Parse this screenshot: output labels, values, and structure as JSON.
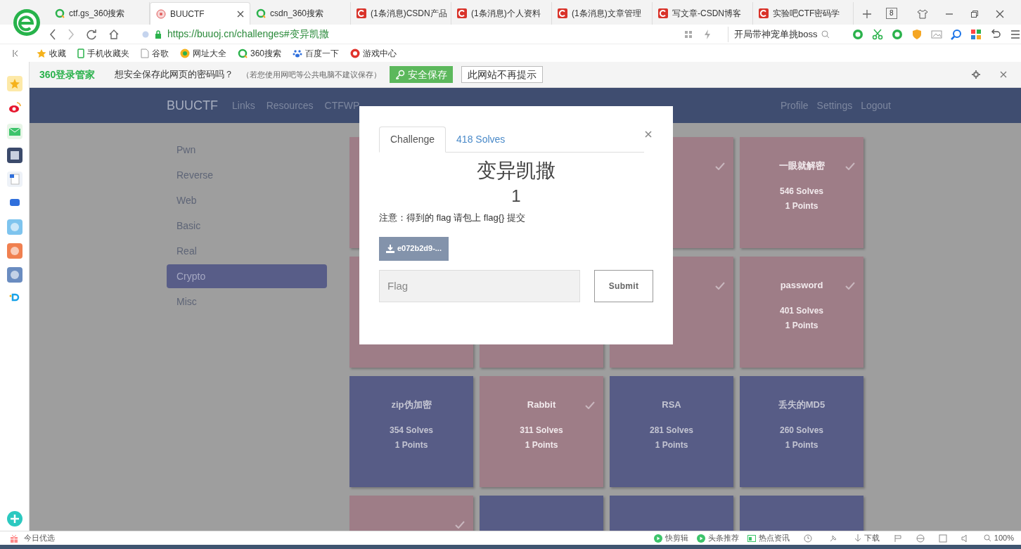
{
  "browser": {
    "tabs": [
      {
        "title": "ctf.gs_360搜索",
        "kind": "search",
        "selected": false
      },
      {
        "title": "BUUCTF",
        "kind": "site",
        "selected": true
      },
      {
        "title": "csdn_360搜索",
        "kind": "search",
        "selected": false
      },
      {
        "title": "(1条消息)CSDN产品",
        "kind": "csdn",
        "selected": false
      },
      {
        "title": "(1条消息)个人资料",
        "kind": "csdn",
        "selected": false
      },
      {
        "title": "(1条消息)文章管理",
        "kind": "csdn",
        "selected": false
      },
      {
        "title": "写文章-CSDN博客",
        "kind": "csdn",
        "selected": false
      },
      {
        "title": "实验吧CTF密码学",
        "kind": "csdn",
        "selected": false
      }
    ],
    "tab_count": "8",
    "address": "https://buuoj.cn/challenges#变异凯撒",
    "search": "开局带神宠单挑boss",
    "bookmarks": [
      {
        "label": "收藏",
        "kind": "star"
      },
      {
        "label": "手机收藏夹",
        "kind": "phone"
      },
      {
        "label": "谷歌",
        "kind": "page"
      },
      {
        "label": "网址大全",
        "kind": "globe"
      },
      {
        "label": "360搜索",
        "kind": "search"
      },
      {
        "label": "百度一下",
        "kind": "paw"
      },
      {
        "label": "游戏中心",
        "kind": "game"
      }
    ],
    "password_bar": {
      "brand": "360登录管家",
      "prompt": "想安全保存此网页的密码吗？",
      "note": "（若您使用网吧等公共电脑不建议保存）",
      "save": "安全保存",
      "never": "此网站不再提示"
    }
  },
  "page": {
    "nav": {
      "brand": "BUUCTF",
      "links": [
        "Links",
        "Resources",
        "CTFWP"
      ],
      "right_links": [
        "Profile",
        "Settings",
        "Logout"
      ]
    },
    "categories": [
      {
        "label": "Pwn",
        "selected": false
      },
      {
        "label": "Reverse",
        "selected": false
      },
      {
        "label": "Web",
        "selected": false
      },
      {
        "label": "Basic",
        "selected": false
      },
      {
        "label": "Real",
        "selected": false
      },
      {
        "label": "Crypto",
        "selected": true
      },
      {
        "label": "Misc",
        "selected": false
      }
    ],
    "challenges": [
      {
        "solved": true
      },
      {
        "solved": true
      },
      {
        "title": "一眼就解密",
        "solves": "546 Solves",
        "points": "1 Points",
        "solved": true
      },
      {
        "solved": true
      },
      {
        "solved": true
      },
      {
        "solved": true
      },
      {
        "title": "password",
        "solves": "401 Solves",
        "points": "1 Points",
        "solved": true
      },
      {
        "title": "zip伪加密",
        "solves": "354 Solves",
        "points": "1 Points",
        "solved": false
      },
      {
        "title": "Rabbit",
        "solves": "311 Solves",
        "points": "1 Points",
        "solved": true
      },
      {
        "title": "RSA",
        "solves": "281 Solves",
        "points": "1 Points",
        "solved": false
      },
      {
        "title": "丢失的MD5",
        "solves": "260 Solves",
        "points": "1 Points",
        "solved": false
      },
      {
        "solved": true
      },
      {
        "solved": false
      },
      {
        "solved": false
      },
      {
        "solved": false
      }
    ]
  },
  "modal": {
    "tabs": [
      {
        "label": "Challenge",
        "selected": true
      },
      {
        "label": "418 Solves",
        "selected": false
      }
    ],
    "title": "变异凯撒",
    "value": "1",
    "description": "注意：得到的 flag 请包上 flag{} 提交",
    "file": "e072b2d9-...",
    "flag_placeholder": "Flag",
    "submit": "Submit"
  },
  "status_bar": {
    "left": "今日优选",
    "items": [
      {
        "label": "快剪辑",
        "kind": "play"
      },
      {
        "label": "头条推荐",
        "kind": "play"
      },
      {
        "label": "热点资讯",
        "kind": "news"
      }
    ],
    "download": "下载",
    "zoom": "100%"
  }
}
